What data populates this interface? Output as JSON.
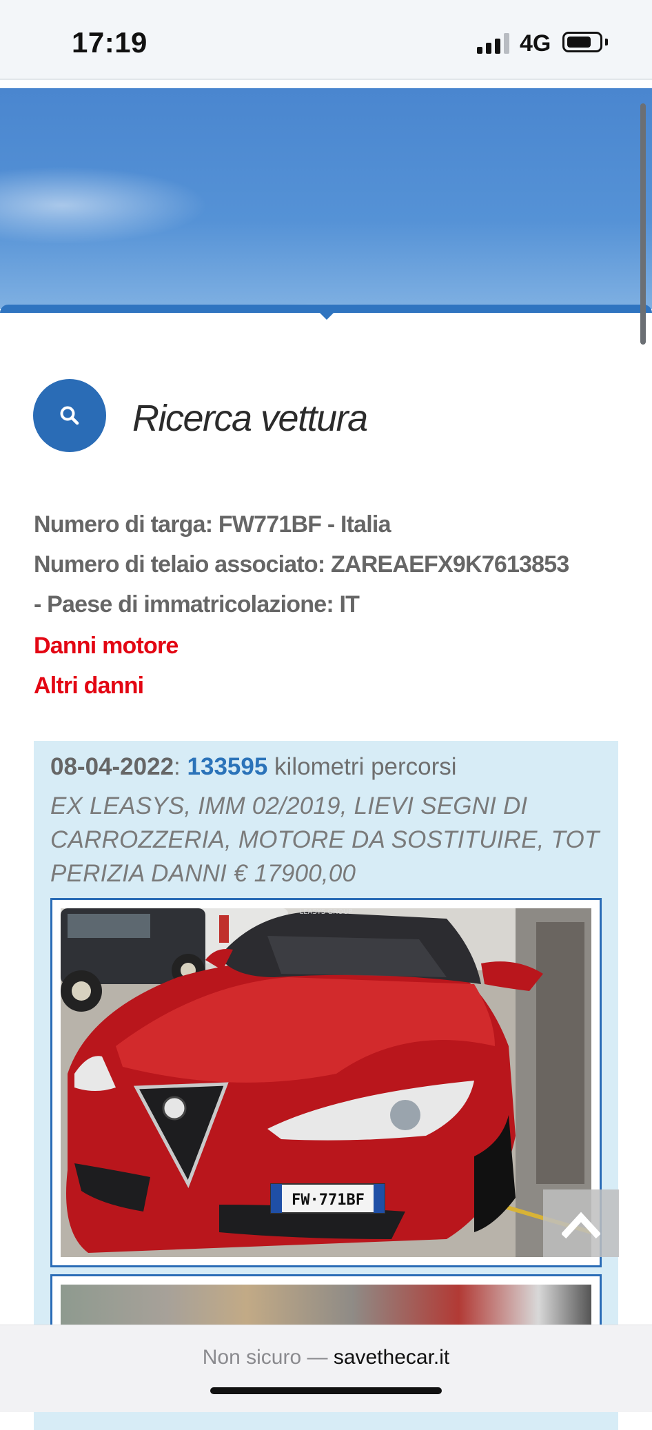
{
  "status_bar": {
    "time": "17:19",
    "network": "4G",
    "signal_bars": 3,
    "signal_bars_total": 4,
    "battery_level": 0.7
  },
  "search_section": {
    "icon": "search-icon",
    "heading": "Ricerca vettura"
  },
  "vehicle": {
    "plate_line": "Numero di targa: FW771BF - Italia",
    "vin_line": "Numero di telaio associato: ZAREAEFX9K7613853",
    "country_line": "- Paese di immatricolazione: IT",
    "damage_engine": "Danni motore",
    "damage_other": "Altri danni"
  },
  "record": {
    "date": "08-04-2022",
    "separator": ":",
    "km": "133595",
    "km_label": "kilometri percorsi",
    "description": "EX LEASYS, IMM 02/2019, LIEVI SEGNI DI CARROZZERIA, MOTORE DA SOSTITUIRE, TOT PERIZIA DANNI € 17900,00",
    "photo_watermark": "LEASYS GROUP",
    "photo_plate": "FW·771BF"
  },
  "back_to_top": {
    "icon": "chevron-up-icon"
  },
  "browser": {
    "url_prefix": "Non sicuro — ",
    "url_domain": "savethecar.it"
  },
  "colors": {
    "accent_blue": "#2a6cb6",
    "damage_red": "#e30613",
    "record_bg": "#d7ecf6",
    "km_blue": "#2b73b9"
  }
}
